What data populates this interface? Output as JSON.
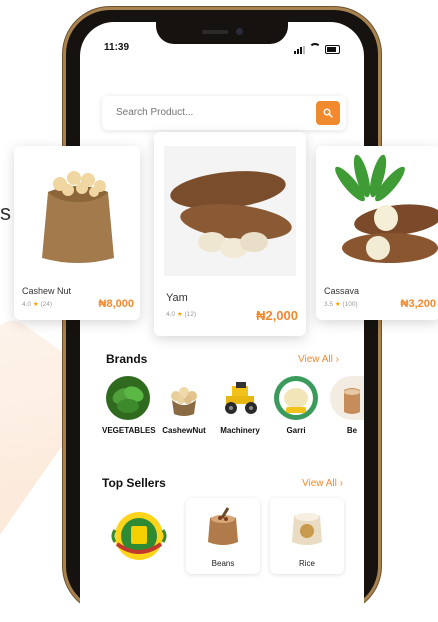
{
  "edge_letter": "s",
  "status_bar": {
    "time": "11:39"
  },
  "search": {
    "placeholder": "Search Product..."
  },
  "products": [
    {
      "name": "Cashew Nut",
      "rating": "4.0",
      "reviews": "(24)",
      "price": "₦8,000"
    },
    {
      "name": "Yam",
      "rating": "4.0",
      "reviews": "(12)",
      "price": "₦2,000"
    },
    {
      "name": "Cassava",
      "rating": "3.5",
      "reviews": "(100)",
      "price": "₦3,200"
    }
  ],
  "brands_section": {
    "title": "Brands",
    "view_all": "View All ›"
  },
  "brands": [
    {
      "label": "VEGETABLES",
      "icon": "vegetables-icon"
    },
    {
      "label": "CashewNut",
      "icon": "cashew-icon"
    },
    {
      "label": "Machinery",
      "icon": "tractor-icon"
    },
    {
      "label": "Garri",
      "icon": "garri-icon",
      "badge": "Garri"
    },
    {
      "label": "Be",
      "icon": "beans-icon"
    }
  ],
  "top_sellers_section": {
    "title": "Top Sellers",
    "view_all": "View All ›"
  },
  "sellers": [
    {
      "label": "",
      "icon": "seller-logo-icon"
    },
    {
      "label": "Beans",
      "icon": "beans-sack-icon"
    },
    {
      "label": "Rice",
      "icon": "rice-sack-icon"
    }
  ],
  "colors": {
    "accent": "#f18a2f",
    "star": "#f4a300",
    "phone_frame": "#a8834f"
  }
}
